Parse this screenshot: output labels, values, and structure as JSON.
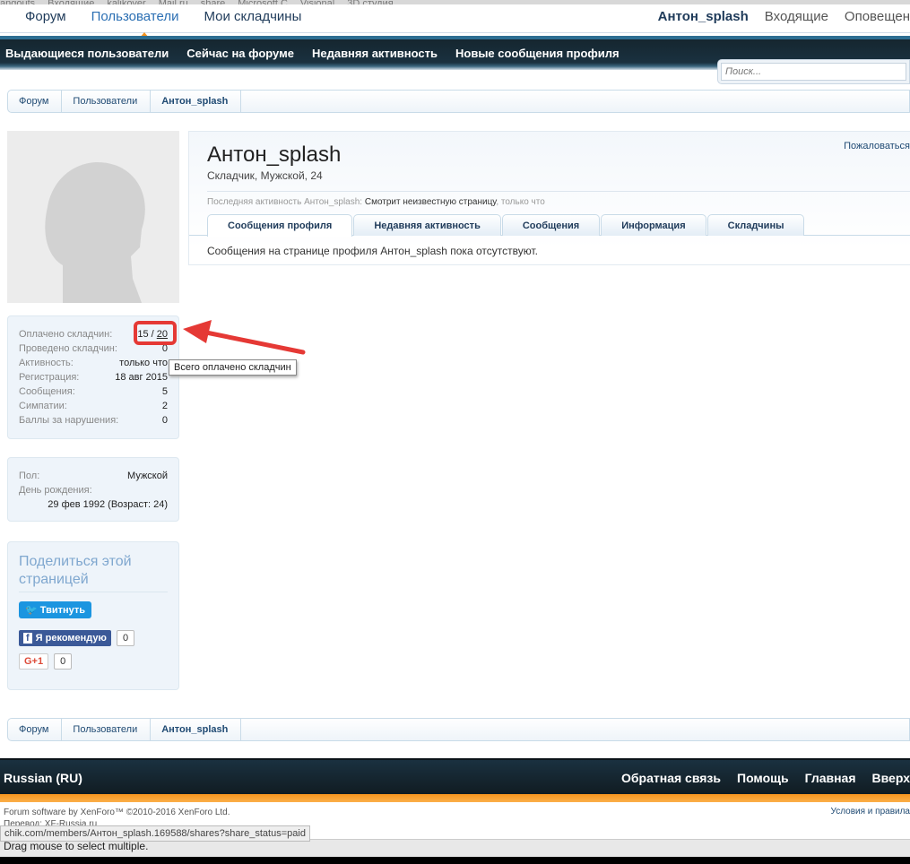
{
  "bookmarks": [
    "angouts",
    "Входящие",
    "kalikover",
    "Mail.ru",
    "share",
    "Microsoft C",
    "Visional",
    "3D студия"
  ],
  "topnav": {
    "left": [
      "Форум",
      "Пользователи",
      "Мои складчины"
    ],
    "right": [
      "Антон_splash",
      "Входящие",
      "Оповещен"
    ]
  },
  "subnav": [
    "Выдающиеся пользователи",
    "Сейчас на форуме",
    "Недавняя активность",
    "Новые сообщения профиля"
  ],
  "search": {
    "placeholder": "Поиск..."
  },
  "breadcrumb": [
    "Форум",
    "Пользователи",
    "Антон_splash"
  ],
  "stats": [
    {
      "k": "Оплачено складчин:",
      "v": "15 / ",
      "link": "20"
    },
    {
      "k": "Проведено складчин:",
      "v": "0"
    },
    {
      "k": "Активность:",
      "v": "только что"
    },
    {
      "k": "Регистрация:",
      "v": "18 авг 2015"
    },
    {
      "k": "Сообщения:",
      "v": "5"
    },
    {
      "k": "Симпатии:",
      "v": "2"
    },
    {
      "k": "Баллы за нарушения:",
      "v": "0"
    }
  ],
  "tooltip": "Всего оплачено складчин",
  "info": {
    "gender_k": "Пол:",
    "gender_v": "Мужской",
    "bday_k": "День рождения:",
    "bday_v": "29 фев 1992 (Возраст: 24)"
  },
  "share": {
    "title": "Поделиться этой страницей",
    "tweet": "Твитнуть",
    "fb": "Я рекомендую",
    "fb_count": "0",
    "gplus": "G+1",
    "gplus_count": "0"
  },
  "profile": {
    "name": "Антон_splash",
    "sub": "Складчик, Мужской, 24",
    "report": "Пожаловаться",
    "last_label": "Последняя активность Антон_splash:",
    "last_action": "Смотрит неизвестную страницу",
    "last_time": ", только что",
    "tabs": [
      "Сообщения профиля",
      "Недавняя активность",
      "Сообщения",
      "Информация",
      "Складчины"
    ],
    "empty": "Сообщения на странице профиля Антон_splash пока отсутствуют."
  },
  "footer": {
    "lang": "Russian (RU)",
    "links": [
      "Обратная связь",
      "Помощь",
      "Главная",
      "Вверх"
    ],
    "copy1": "Forum software by XenForo™ ©2010-2016 XenForo Ltd.",
    "copy2": "Перевод: XF-Russia.ru",
    "terms": "Условия и правила"
  },
  "statusbar": "chik.com/members/Антон_splash.169588/shares?share_status=paid",
  "drag_hint": "Drag mouse to select multiple."
}
